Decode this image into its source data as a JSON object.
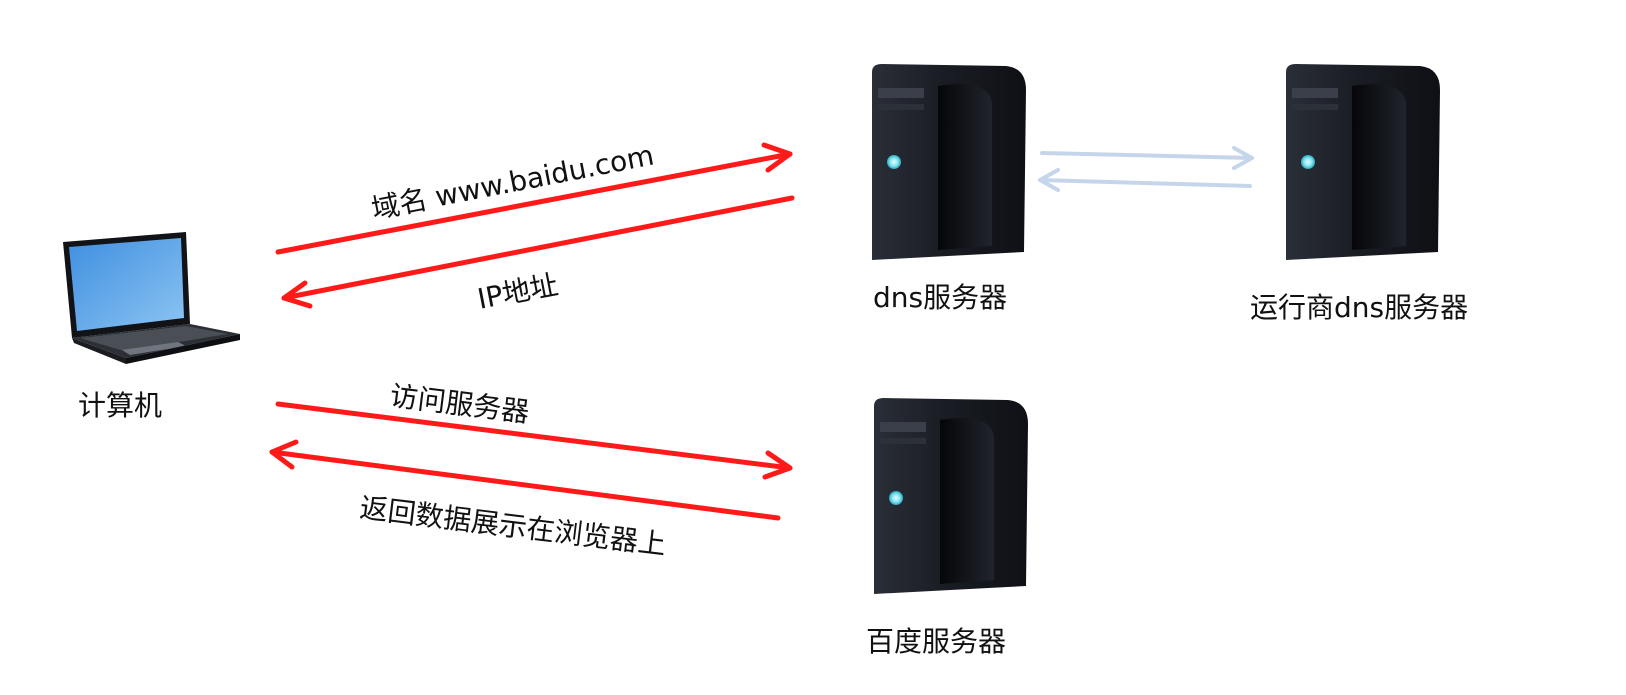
{
  "nodes": {
    "computer": {
      "label": "计算机",
      "icon": "laptop-icon"
    },
    "dns_server": {
      "label": "dns服务器",
      "icon": "server-icon"
    },
    "carrier_dns_server": {
      "label": "运行商dns服务器",
      "icon": "server-icon"
    },
    "baidu_server": {
      "label": "百度服务器",
      "icon": "server-icon"
    }
  },
  "edges": {
    "domain_request": {
      "label": "域名 www.baidu.com",
      "from": "computer",
      "to": "dns_server"
    },
    "ip_response": {
      "label": "IP地址",
      "from": "dns_server",
      "to": "computer"
    },
    "access_server": {
      "label": "访问服务器",
      "from": "computer",
      "to": "baidu_server"
    },
    "return_data": {
      "label": "返回数据展示在浏览器上",
      "from": "baidu_server",
      "to": "computer"
    },
    "dns_forward": {
      "label": "",
      "from": "dns_server",
      "to": "carrier_dns_server"
    },
    "dns_back": {
      "label": "",
      "from": "carrier_dns_server",
      "to": "dns_server"
    }
  },
  "colors": {
    "primary_arrow": "#ff1a1a",
    "secondary_arrow": "#c5d6ea",
    "server_body": "#1c1f26",
    "server_light": "#7fe3f2",
    "laptop_screen": "#5aa3ea"
  }
}
